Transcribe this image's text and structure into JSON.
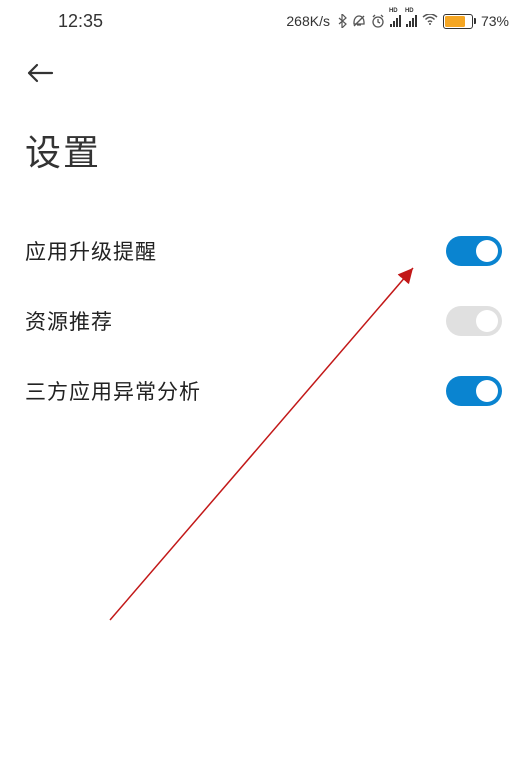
{
  "status_bar": {
    "time": "12:35",
    "network_speed": "268K/s",
    "battery_percent": "73%"
  },
  "page": {
    "title": "设置"
  },
  "settings": [
    {
      "label": "应用升级提醒",
      "enabled": true
    },
    {
      "label": "资源推荐",
      "enabled": false
    },
    {
      "label": "三方应用异常分析",
      "enabled": true
    }
  ]
}
